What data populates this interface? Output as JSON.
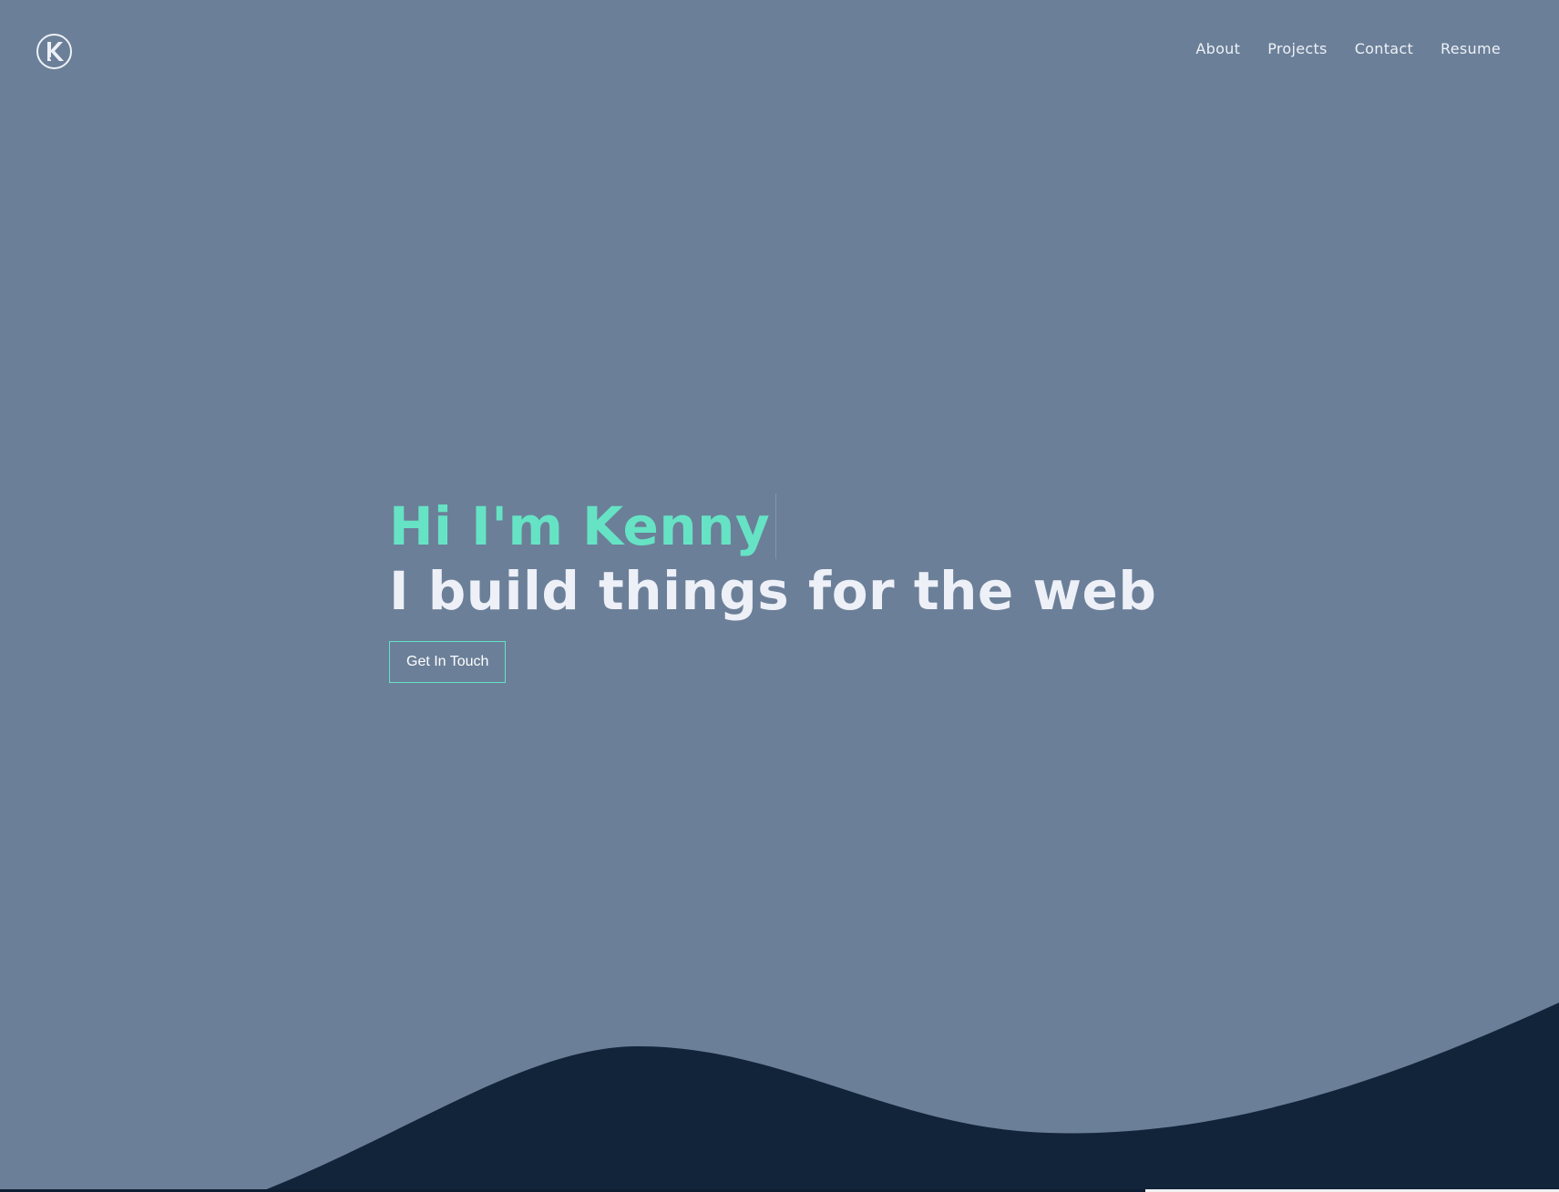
{
  "header": {
    "logo_icon": "k-monogram-logo-icon",
    "nav": [
      {
        "label": "About"
      },
      {
        "label": "Projects"
      },
      {
        "label": "Contact"
      },
      {
        "label": "Resume"
      }
    ]
  },
  "hero": {
    "greeting": "Hi I'm Kenny",
    "tagline": "I build things for the web",
    "cta_label": "Get In Touch"
  },
  "colors": {
    "background": "#6b7f98",
    "accent": "#66e3c4",
    "wave": "#12243a",
    "text_light": "#eef0f7"
  }
}
